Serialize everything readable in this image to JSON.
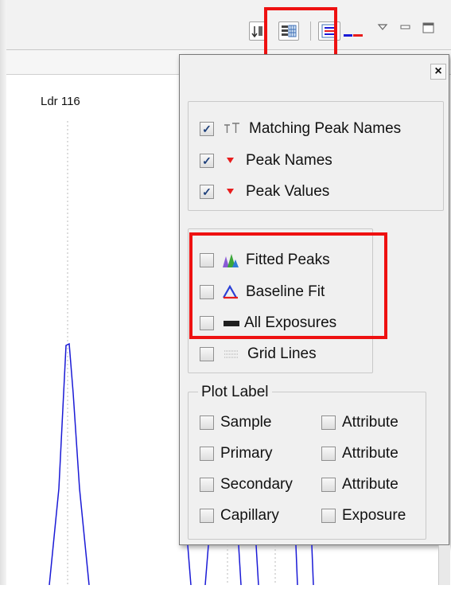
{
  "plot": {
    "label": "Ldr 116"
  },
  "popup": {
    "peak_options": [
      {
        "label": "Matching Peak Names",
        "checked": true,
        "icon": "matching-peak-names-icon"
      },
      {
        "label": "Peak Names",
        "checked": true,
        "icon": "peak-names-icon"
      },
      {
        "label": "Peak Values",
        "checked": true,
        "icon": "peak-values-icon"
      }
    ],
    "display_options": [
      {
        "label": "Fitted Peaks",
        "checked": false,
        "icon": "fitted-peaks-icon"
      },
      {
        "label": "Baseline Fit",
        "checked": false,
        "icon": "baseline-fit-icon"
      },
      {
        "label": "All Exposures",
        "checked": false,
        "icon": "all-exposures-icon"
      },
      {
        "label": "Grid Lines",
        "checked": false,
        "icon": "grid-lines-icon"
      }
    ],
    "plot_label": {
      "title": "Plot Label",
      "rows": [
        {
          "left": "Sample",
          "right": "Attribute"
        },
        {
          "left": "Primary",
          "right": "Attribute"
        },
        {
          "left": "Secondary",
          "right": "Attribute"
        },
        {
          "left": "Capillary",
          "right": "Exposure"
        }
      ]
    },
    "close_glyph": "×"
  },
  "colors": {
    "highlight": "#ee1111",
    "trace": "#1a1ad6",
    "popup_bg": "#f0f0f0"
  }
}
